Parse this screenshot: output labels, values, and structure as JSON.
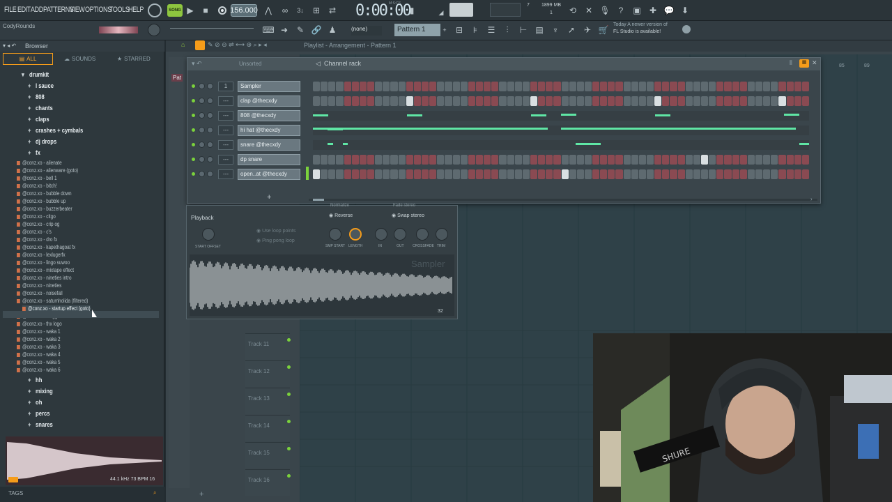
{
  "menu": {
    "items": [
      "FILE",
      "EDIT",
      "ADD",
      "PATTERNS",
      "VIEW",
      "OPTIONS",
      "TOOLS",
      "HELP"
    ],
    "song_label": "SONG",
    "bpm": "156.000",
    "time": "0:00:00",
    "time_unit": "M:S:CS",
    "cpu_mem": "1899 MB",
    "cpu_top": "7",
    "cpu_bot": "1"
  },
  "toolbar2": {
    "channel_hint": "CodyRounds",
    "none_label": "(none)",
    "pattern_label": "Pattern 1",
    "update_line1": "Today  A newer version of",
    "update_line2": "FL Studio is available!"
  },
  "browser": {
    "title": "Browser",
    "tabs": [
      "ALL",
      "SOUNDS",
      "STARRED"
    ],
    "folders_top": [
      "drumkit",
      "l sauce",
      "808",
      "chants",
      "claps",
      "crashes + cymbals",
      "dj drops",
      "fx"
    ],
    "files": [
      "@conz.xo - alienate",
      "@conz.xo - alienware (goto)",
      "@conz.xo - bell 1",
      "@conz.xo - bitch!",
      "@conz.xo - bubble down",
      "@conz.xo - bubble up",
      "@conz.xo - buzzerbeater",
      "@conz.xo - citgo",
      "@conz.xo - crip og",
      "@conz.xo - c's",
      "@conz.xo - dro fx",
      "@conz.xo - kapethagoat fx",
      "@conz.xo - lexlugerfx",
      "@conz.xo - lingo suwoo",
      "@conz.xo - mixtape effect",
      "@conz.xo - nineties intro",
      "@conz.xo - nineties",
      "@conz.xo - noisefall",
      "@conz.xo - saturnholida (filtered)",
      "@conz.xo - startup effect (goto)",
      "@conz.xo - thuggeffx",
      "@conz.xo - thx logo",
      "@conz.xo - waka 1",
      "@conz.xo - waka 2",
      "@conz.xo - waka 3",
      "@conz.xo - waka 4",
      "@conz.xo - waka 5",
      "@conz.xo - waka 6"
    ],
    "selected_index": 19,
    "folders_bottom": [
      "hh",
      "mixing",
      "oh",
      "percs",
      "snares"
    ],
    "preview_info": "44.1 kHz 73 BPM 16",
    "tags_label": "TAGS"
  },
  "playlist": {
    "title": "Playlist - Arrangement - Pattern 1",
    "pattern_tab": "Pat",
    "ruler": [
      "85",
      "89"
    ],
    "tracks": [
      "Track 11",
      "Track 12",
      "Track 13",
      "Track 14",
      "Track 15",
      "Track 16"
    ]
  },
  "channel_rack": {
    "title": "Channel rack",
    "filter": "Unsorted",
    "channels": [
      {
        "num": "1",
        "name": "Sampler",
        "mode": "steps",
        "lit": []
      },
      {
        "num": "---",
        "name": "clap @thecxdy",
        "mode": "steps",
        "lit": [
          12,
          28,
          44,
          60
        ]
      },
      {
        "num": "---",
        "name": "808 @thecxdy",
        "mode": "notes",
        "notes": [
          [
            0,
            3,
            5
          ],
          [
            19,
            3,
            5
          ],
          [
            44,
            3,
            5
          ],
          [
            50,
            3,
            4
          ],
          [
            69,
            3,
            5
          ],
          [
            95,
            3,
            4
          ]
        ]
      },
      {
        "num": "---",
        "name": "hi hat @thecxdy",
        "mode": "notes",
        "notes": [
          [
            0,
            37,
            3
          ],
          [
            3,
            3,
            4
          ],
          [
            50,
            37,
            3
          ]
        ]
      },
      {
        "num": "---",
        "name": "snare @thecxdy",
        "mode": "notes",
        "notes": [
          [
            3,
            1,
            4
          ],
          [
            6,
            1,
            4
          ],
          [
            53,
            5,
            4
          ],
          [
            98,
            2,
            4
          ]
        ]
      },
      {
        "num": "---",
        "name": "dp snare",
        "mode": "steps",
        "lit": [
          50
        ]
      },
      {
        "num": "---",
        "name": "open..at @thecxdy",
        "mode": "steps",
        "lit": [
          0,
          32
        ]
      }
    ],
    "add_label": "+"
  },
  "sampler": {
    "section": "Playback",
    "options": [
      "Use loop points",
      "Ping pong loop"
    ],
    "checks": [
      "Reverse",
      "Swap stereo"
    ],
    "top_checks": [
      "Normalize",
      "Fade stereo"
    ],
    "knobs_left": [
      "START OFFSET"
    ],
    "knobs_right": [
      "SMP START",
      "LENGTH",
      "IN",
      "OUT",
      "CROSSFADE",
      "TRIM"
    ],
    "watermark": "Sampler",
    "page": "32"
  },
  "colors": {
    "accent": "#f59c1a",
    "note": "#5fe6a5",
    "song": "#8ec63f",
    "step_red": "#8a4a52",
    "step_grey": "#5e6a70"
  }
}
